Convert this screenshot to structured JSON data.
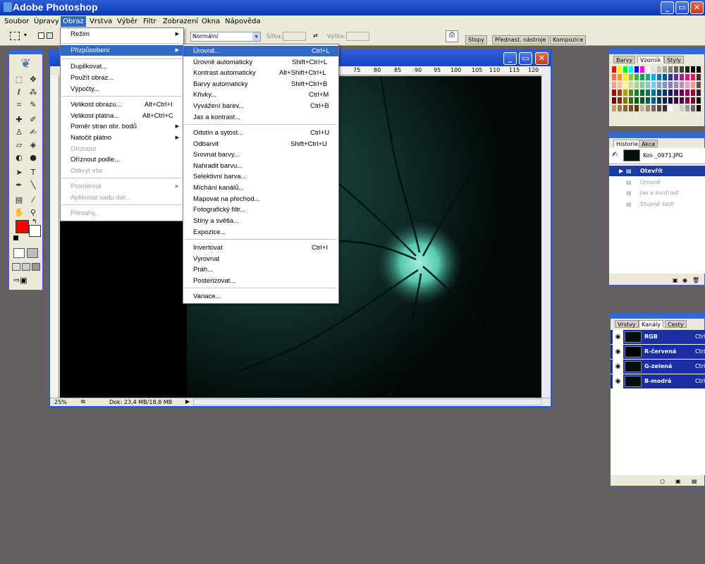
{
  "app": {
    "title": "Adobe Photoshop"
  },
  "menubar": [
    "Soubor",
    "Úpravy",
    "Obraz",
    "Vrstva",
    "Výběr",
    "Filtr",
    "Zobrazení",
    "Okna",
    "Nápověda"
  ],
  "options": {
    "mode_label": "Normální",
    "width_label": "Šířka:",
    "height_label": "Výška:",
    "tabs": [
      "Stopy",
      "Přednast. nástroje",
      "Kompozice"
    ]
  },
  "image_menu": {
    "items": [
      {
        "label": "Režim",
        "submenu": true
      },
      {
        "label": "Přizpůsobení",
        "submenu": true,
        "highlight": true
      },
      {
        "label": "Duplikovat..."
      },
      {
        "label": "Použít obraz..."
      },
      {
        "label": "Výpočty..."
      },
      {
        "label": "Velikost obrazu...",
        "shortcut": "Alt+Ctrl+I"
      },
      {
        "label": "Velikost plátna...",
        "shortcut": "Alt+Ctrl+C"
      },
      {
        "label": "Poměr stran obr. bodů",
        "submenu": true
      },
      {
        "label": "Natočit plátno",
        "submenu": true
      },
      {
        "label": "Oříznout",
        "disabled": true
      },
      {
        "label": "Oříznout podle..."
      },
      {
        "label": "Odkrýt vše",
        "disabled": true
      },
      {
        "label": "Proměnné",
        "submenu": true,
        "disabled": true
      },
      {
        "label": "Aplikovat sadu dat...",
        "disabled": true
      },
      {
        "label": "Přesahy...",
        "disabled": true
      }
    ]
  },
  "adjust_menu": {
    "items": [
      {
        "label": "Úrovně...",
        "shortcut": "Ctrl+L",
        "highlight": true
      },
      {
        "label": "Úrovně automaticky",
        "shortcut": "Shift+Ctrl+L"
      },
      {
        "label": "Kontrast automaticky",
        "shortcut": "Alt+Shift+Ctrl+L"
      },
      {
        "label": "Barvy automaticky",
        "shortcut": "Shift+Ctrl+B"
      },
      {
        "label": "Křivky...",
        "shortcut": "Ctrl+M"
      },
      {
        "label": "Vyvážení barev...",
        "shortcut": "Ctrl+B"
      },
      {
        "label": "Jas a kontrast..."
      },
      {
        "label": "Odstín a sytost...",
        "shortcut": "Ctrl+U"
      },
      {
        "label": "Odbarvit",
        "shortcut": "Shift+Ctrl+U"
      },
      {
        "label": "Srovnat barvy..."
      },
      {
        "label": "Nahradit barvu..."
      },
      {
        "label": "Selektivní barva..."
      },
      {
        "label": "Míchání kanálů..."
      },
      {
        "label": "Mapovat na přechod..."
      },
      {
        "label": "Fotografický filtr..."
      },
      {
        "label": "Stíny a světla..."
      },
      {
        "label": "Expozice..."
      },
      {
        "label": "Invertovat",
        "shortcut": "Ctrl+I"
      },
      {
        "label": "Vyrovnat"
      },
      {
        "label": "Práh..."
      },
      {
        "label": "Posterizovat..."
      },
      {
        "label": "Variace..."
      }
    ]
  },
  "document": {
    "zoom": "25%",
    "doc_info": "Dok: 23,4 MB/18,8 MB",
    "ruler_labels": [
      "75",
      "80",
      "85",
      "90",
      "95",
      "100",
      "105",
      "110",
      "115",
      "120"
    ]
  },
  "swatches_palette": {
    "tabs": [
      "Barvy",
      "Vzorník",
      "Styly"
    ]
  },
  "history_palette": {
    "tabs": [
      "Historie",
      "Akce"
    ],
    "snapshot": "Kos _0971.JPG",
    "steps": [
      {
        "label": "Otevřít",
        "active": true
      },
      {
        "label": "Úrovně"
      },
      {
        "label": "Jas a kontrast"
      },
      {
        "label": "Stupně šedi"
      }
    ]
  },
  "layers_palette": {
    "tabs": [
      "Vrstvy",
      "Kanály",
      "Cesty"
    ],
    "channels": [
      {
        "name": "RGB",
        "shortcut": "Ctrl"
      },
      {
        "name": "R-červená",
        "shortcut": "Ctrl"
      },
      {
        "name": "G-zelená",
        "shortcut": "Ctrl"
      },
      {
        "name": "B-modrá",
        "shortcut": "Ctrl"
      }
    ]
  },
  "colors": {
    "foreground": "#ff0000",
    "background": "#ffffff",
    "menu_highlight": "#316ac5"
  }
}
